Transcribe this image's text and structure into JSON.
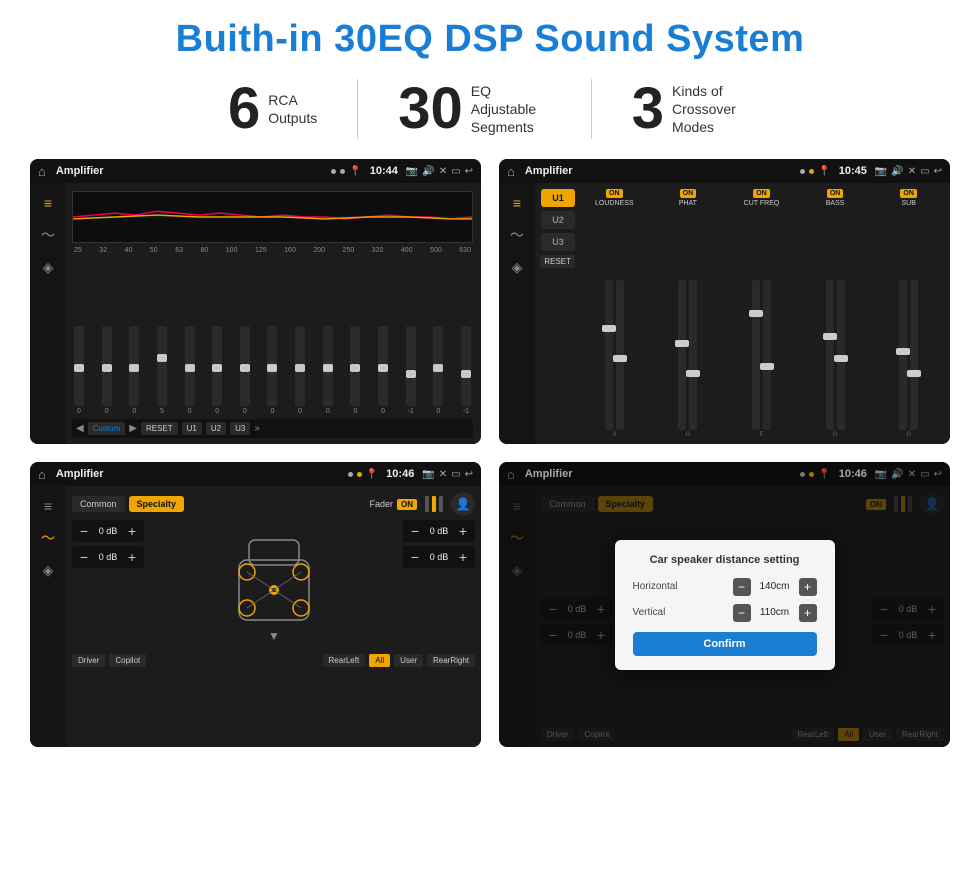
{
  "header": {
    "title": "Buith-in 30EQ DSP Sound System"
  },
  "stats": [
    {
      "number": "6",
      "label": "RCA\nOutputs"
    },
    {
      "number": "30",
      "label": "EQ Adjustable\nSegments"
    },
    {
      "number": "3",
      "label": "Kinds of\nCrossover Modes"
    }
  ],
  "screens": [
    {
      "id": "eq-screen",
      "statusTitle": "Amplifier",
      "statusTime": "10:44",
      "freqLabels": [
        "25",
        "32",
        "40",
        "50",
        "63",
        "80",
        "100",
        "125",
        "160",
        "200",
        "250",
        "320",
        "400",
        "500",
        "630"
      ],
      "sliderValues": [
        "0",
        "0",
        "0",
        "5",
        "0",
        "0",
        "0",
        "0",
        "0",
        "0",
        "0",
        "0",
        "-1",
        "0",
        "-1"
      ],
      "bottomBtns": [
        "Custom",
        "RESET",
        "U1",
        "U2",
        "U3"
      ]
    },
    {
      "id": "dsp-screen",
      "statusTitle": "Amplifier",
      "statusTime": "10:45",
      "presets": [
        "U1",
        "U2",
        "U3"
      ],
      "channels": [
        "LOUDNESS",
        "PHAT",
        "CUT FREQ",
        "BASS",
        "SUB"
      ],
      "resetLabel": "RESET"
    },
    {
      "id": "fader-screen",
      "statusTitle": "Amplifier",
      "statusTime": "10:46",
      "tabs": [
        "Common",
        "Specialty"
      ],
      "faderLabel": "Fader",
      "onLabel": "ON",
      "dbValues": [
        "0 dB",
        "0 dB",
        "0 dB",
        "0 dB"
      ],
      "bottomBtns": [
        "Driver",
        "Copilot",
        "RearLeft",
        "All",
        "User",
        "RearRight"
      ]
    },
    {
      "id": "dialog-screen",
      "statusTitle": "Amplifier",
      "statusTime": "10:46",
      "tabs": [
        "Common",
        "Specialty"
      ],
      "dialog": {
        "title": "Car speaker distance setting",
        "rows": [
          {
            "label": "Horizontal",
            "value": "140cm"
          },
          {
            "label": "Vertical",
            "value": "110cm"
          }
        ],
        "confirmLabel": "Confirm"
      },
      "bottomBtns": [
        "Driver",
        "Copilot",
        "RearLeft",
        "All",
        "User",
        "RearRight"
      ]
    }
  ]
}
